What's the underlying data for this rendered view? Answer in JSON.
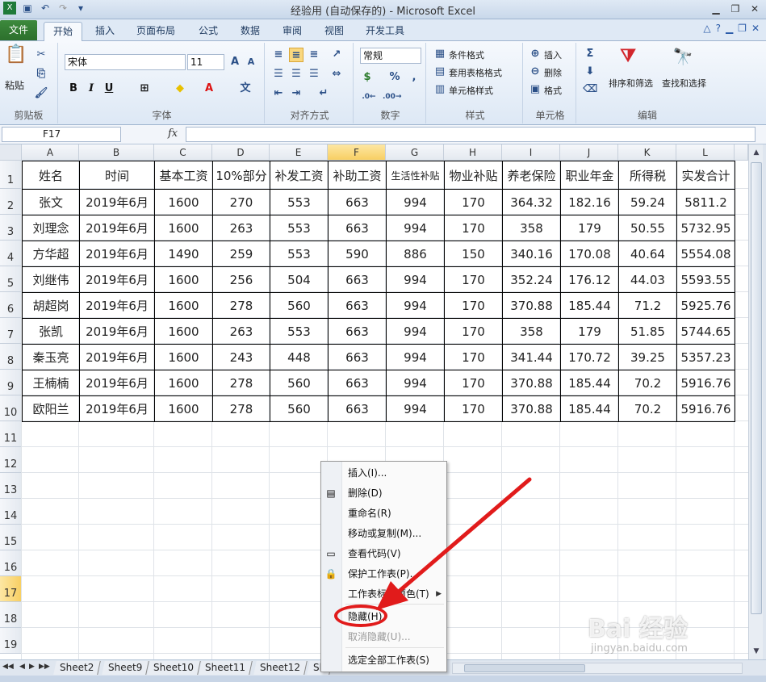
{
  "window": {
    "title": "经验用 (自动保存的) - Microsoft Excel"
  },
  "ribbon_tabs": [
    "文件",
    "开始",
    "插入",
    "页面布局",
    "公式",
    "数据",
    "审阅",
    "视图",
    "开发工具"
  ],
  "ribbon": {
    "paste_label": "粘贴",
    "clipboard_group": "剪贴板",
    "font_name": "宋体",
    "font_size": "11",
    "font_group": "字体",
    "alignment_group": "对齐方式",
    "number_format": "常规",
    "number_group": "数字",
    "conditional_format": "条件格式",
    "table_format": "套用表格格式",
    "cell_styles": "单元格样式",
    "styles_group": "样式",
    "insert": "插入",
    "delete": "删除",
    "format": "格式",
    "cells_group": "单元格",
    "sort_filter": "排序和筛选",
    "find_select": "查找和选择",
    "editing_group": "编辑"
  },
  "formula_bar": {
    "name_box": "F17",
    "fx": "fx",
    "formula": ""
  },
  "columns": [
    "A",
    "B",
    "C",
    "D",
    "E",
    "F",
    "G",
    "H",
    "I",
    "J",
    "K",
    "L"
  ],
  "selected_column": "F",
  "selected_row": "17",
  "rows": [
    "1",
    "2",
    "3",
    "4",
    "5",
    "6",
    "7",
    "8",
    "9",
    "10",
    "11",
    "12",
    "13",
    "14",
    "15",
    "16",
    "17",
    "18",
    "19"
  ],
  "table": {
    "headers": [
      "姓名",
      "时间",
      "基本工资",
      "10%部分",
      "补发工资",
      "补助工资",
      "生活性补贴",
      "物业补贴",
      "养老保险",
      "职业年金",
      "所得税",
      "实发合计"
    ],
    "rows": [
      [
        "张文",
        "2019年6月",
        "1600",
        "270",
        "553",
        "663",
        "994",
        "170",
        "364.32",
        "182.16",
        "59.24",
        "5811.2"
      ],
      [
        "刘理念",
        "2019年6月",
        "1600",
        "263",
        "553",
        "663",
        "994",
        "170",
        "358",
        "179",
        "50.55",
        "5732.95"
      ],
      [
        "方华超",
        "2019年6月",
        "1490",
        "259",
        "553",
        "590",
        "886",
        "150",
        "340.16",
        "170.08",
        "40.64",
        "5554.08"
      ],
      [
        "刘继伟",
        "2019年6月",
        "1600",
        "256",
        "504",
        "663",
        "994",
        "170",
        "352.24",
        "176.12",
        "44.03",
        "5593.55"
      ],
      [
        "胡超岗",
        "2019年6月",
        "1600",
        "278",
        "560",
        "663",
        "994",
        "170",
        "370.88",
        "185.44",
        "71.2",
        "5925.76"
      ],
      [
        "张凯",
        "2019年6月",
        "1600",
        "263",
        "553",
        "663",
        "994",
        "170",
        "358",
        "179",
        "51.85",
        "5744.65"
      ],
      [
        "秦玉亮",
        "2019年6月",
        "1600",
        "243",
        "448",
        "663",
        "994",
        "170",
        "341.44",
        "170.72",
        "39.25",
        "5357.23"
      ],
      [
        "王楠楠",
        "2019年6月",
        "1600",
        "278",
        "560",
        "663",
        "994",
        "170",
        "370.88",
        "185.44",
        "70.2",
        "5916.76"
      ],
      [
        "欧阳兰",
        "2019年6月",
        "1600",
        "278",
        "560",
        "663",
        "994",
        "170",
        "370.88",
        "185.44",
        "70.2",
        "5916.76"
      ]
    ]
  },
  "sheet_tabs": [
    "Sheet2",
    "Sheet9",
    "Sheet10",
    "Sheet11",
    "Sheet12",
    "Sh"
  ],
  "context_menu": {
    "items": [
      {
        "label": "插入(I)...",
        "icon": "none",
        "disabled": false
      },
      {
        "label": "删除(D)",
        "icon": "delete-sheet-icon",
        "disabled": false
      },
      {
        "label": "重命名(R)",
        "icon": "none",
        "disabled": false
      },
      {
        "label": "移动或复制(M)...",
        "icon": "none",
        "disabled": false
      },
      {
        "label": "查看代码(V)",
        "icon": "view-code-icon",
        "disabled": false
      },
      {
        "label": "保护工作表(P)...",
        "icon": "lock-icon",
        "disabled": false
      },
      {
        "label": "工作表标签颜色(T)",
        "icon": "none",
        "disabled": false,
        "submenu": true
      },
      {
        "label": "隐藏(H)",
        "icon": "none",
        "disabled": false
      },
      {
        "label": "取消隐藏(U)...",
        "icon": "none",
        "disabled": true
      },
      {
        "label": "选定全部工作表(S)",
        "icon": "none",
        "disabled": false
      }
    ]
  },
  "watermark": {
    "main": "Bai 经验",
    "sub": "jingyan.baidu.com"
  },
  "colors": {
    "highlight": "#e11b1b",
    "file_tab": "#2c6f2c",
    "selection": "#f8cf63"
  }
}
